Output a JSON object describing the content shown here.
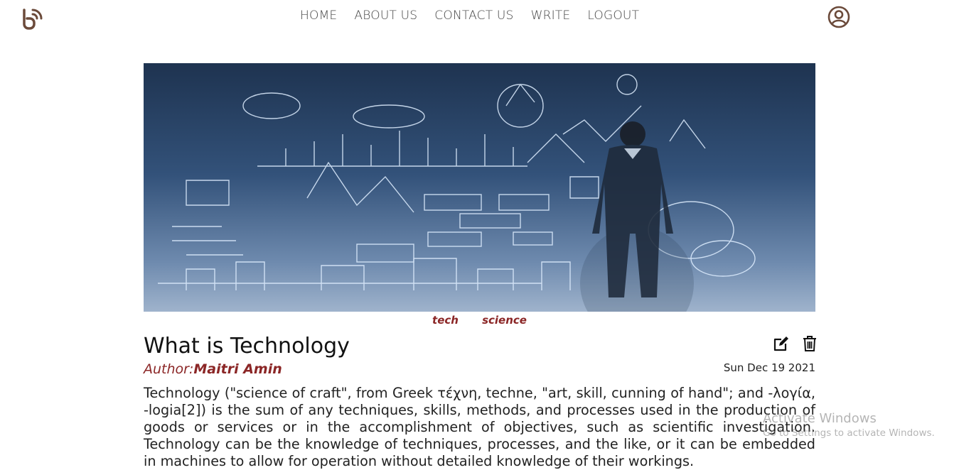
{
  "nav": {
    "items": [
      {
        "label": "HOME"
      },
      {
        "label": "ABOUT US"
      },
      {
        "label": "CONTACT US"
      },
      {
        "label": "WRITE"
      },
      {
        "label": "LOGOUT"
      }
    ]
  },
  "icons": {
    "logo": "blogger-logo-icon",
    "user": "user-circle-icon",
    "edit": "edit-icon",
    "delete": "trash-icon"
  },
  "post": {
    "tags": [
      "tech",
      "science"
    ],
    "title": "What is Technology",
    "author_label": "Author:",
    "author_name": "Maitri Amin",
    "date": "Sun Dec 19 2021",
    "body": "Technology (\"science of craft\", from Greek τέχνη, techne, \"art, skill, cunning of hand\"; and -λογία, -logia[2]) is the sum of any techniques, skills, methods, and processes used in the production of goods or services or in the accomplishment of objectives, such as scientific investigation. Technology can be the knowledge of techniques, processes, and the like, or it can be embedded in machines to allow for operation without detailed knowledge of their workings."
  },
  "watermark": {
    "title": "Activate Windows",
    "subtitle": "Go to Settings to activate Windows."
  },
  "colors": {
    "accent": "#8b2626",
    "logo": "#6b4a3a"
  }
}
